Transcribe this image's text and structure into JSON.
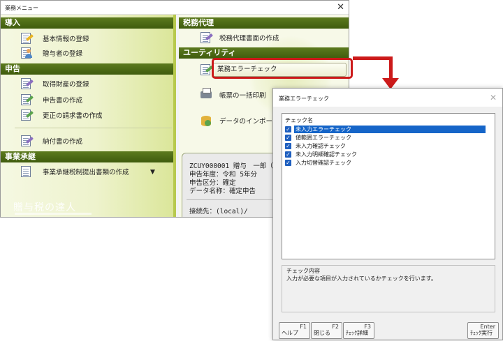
{
  "main_window": {
    "title": "業務メニュー",
    "close_glyph": "✕"
  },
  "left_pane": {
    "sections": [
      {
        "title": "導入",
        "items": [
          {
            "label": "基本情報の登録",
            "icon": "document-pen-icon"
          },
          {
            "label": "贈与者の登録",
            "icon": "person-card-icon"
          }
        ]
      },
      {
        "title": "申告",
        "items": [
          {
            "label": "取得財産の登録",
            "icon": "document-pen-icon"
          },
          {
            "label": "申告書の作成",
            "icon": "document-pen-icon"
          },
          {
            "label": "更正の請求書の作成",
            "icon": "document-pen-icon"
          },
          {
            "label": "納付書の作成",
            "icon": "document-pen-icon"
          }
        ]
      },
      {
        "title": "事業承継",
        "items": [
          {
            "label": "事業承継税制提出書類の作成",
            "icon": "document-icon"
          }
        ]
      }
    ],
    "dropdown_glyph": "▼",
    "brand_logo": "贈与税の達人"
  },
  "right_pane": {
    "sections": [
      {
        "title": "税務代理",
        "items": [
          {
            "label": "税務代理書面の作成",
            "icon": "document-pen-icon"
          }
        ]
      },
      {
        "title": "ユーティリティ",
        "items": [
          {
            "label": "業務エラーチェック",
            "icon": "checklist-icon",
            "highlighted": true
          },
          {
            "label": "帳票の一括印刷",
            "icon": "printer-icon"
          },
          {
            "label": "データのインポー",
            "icon": "database-icon"
          }
        ]
      }
    ],
    "info_panel": {
      "line1": "ZCUY000001 贈与　一郎（所",
      "line2": "申告年度：令和 5年分",
      "line3": "申告区分：確定",
      "line4": "データ名称：確定申告",
      "connection": "接続先：(local)/"
    }
  },
  "dialog": {
    "title": "業務エラーチェック",
    "close_glyph": "✕",
    "list_header": "チェック名",
    "checks": [
      {
        "label": "未入力エラーチェック",
        "checked": true,
        "selected": true
      },
      {
        "label": "値範囲エラーチェック",
        "checked": true,
        "selected": false
      },
      {
        "label": "未入力確認チェック",
        "checked": true,
        "selected": false
      },
      {
        "label": "未入力明細確認チェック",
        "checked": true,
        "selected": false
      },
      {
        "label": "入力切替確認チェック",
        "checked": true,
        "selected": false
      }
    ],
    "check_mark": "✓",
    "description_title": "チェック内容",
    "description_text": "入力が必要な項目が入力されているかチェックを行います。",
    "function_keys": [
      {
        "key": "F1",
        "label": "ヘルプ"
      },
      {
        "key": "F2",
        "label": "閉じる"
      },
      {
        "key": "F3",
        "label": "ﾁｪｯｸ詳細"
      },
      {
        "key": "Enter",
        "label": "ﾁｪｯｸ実行"
      }
    ]
  },
  "colors": {
    "section_header": "#4a6814",
    "highlight_frame": "#cc1a1a",
    "selection": "#1565c8",
    "checkbox": "#1f5fbf"
  }
}
